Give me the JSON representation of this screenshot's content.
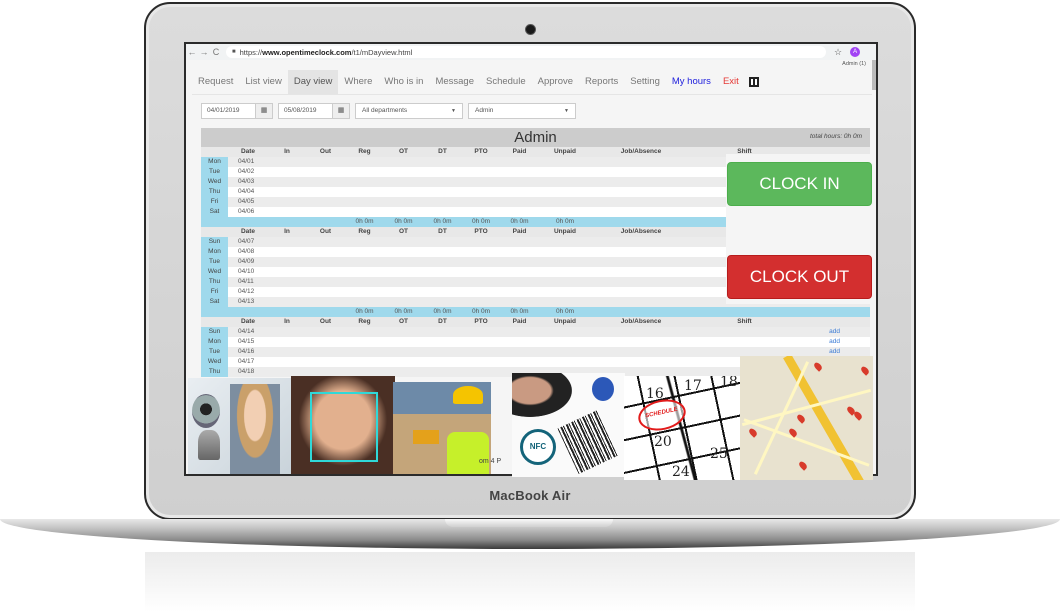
{
  "device": {
    "brand_label": "MacBook Air"
  },
  "browser": {
    "url_prefix": "https://",
    "url_domain": "www.opentimeclock.com",
    "url_path": "/t1/mDayview.html",
    "back_icon": "←",
    "forward_icon": "→",
    "reload_icon": "C",
    "lock_icon": "🔒",
    "star_icon": "☆",
    "avatar_letter": "A",
    "user_label": "Admin (1)"
  },
  "nav": {
    "tabs": [
      {
        "label": "Request"
      },
      {
        "label": "List view"
      },
      {
        "label": "Day view",
        "active": true
      },
      {
        "label": "Where"
      },
      {
        "label": "Who is in"
      },
      {
        "label": "Message"
      },
      {
        "label": "Schedule"
      },
      {
        "label": "Approve"
      },
      {
        "label": "Reports"
      },
      {
        "label": "Setting"
      },
      {
        "label": "My hours"
      },
      {
        "label": "Exit"
      }
    ],
    "qr_icon": "qr-code-icon"
  },
  "filters": {
    "start_date": "04/01/2019",
    "end_date": "05/08/2019",
    "calendar_icon": "▦",
    "department": "All departments",
    "employee": "Admin",
    "caret": "▼"
  },
  "timesheet": {
    "employee_name": "Admin",
    "total_hours": "total hours: 0h 0m",
    "headers": [
      "Date",
      "In",
      "Out",
      "Reg",
      "OT",
      "DT",
      "PTO",
      "Paid",
      "Unpaid",
      "Job/Absence",
      "Shift"
    ],
    "weeks": [
      {
        "days": [
          {
            "day": "Mon",
            "date": "04/01"
          },
          {
            "day": "Tue",
            "date": "04/02"
          },
          {
            "day": "Wed",
            "date": "04/03"
          },
          {
            "day": "Thu",
            "date": "04/04"
          },
          {
            "day": "Fri",
            "date": "04/05"
          },
          {
            "day": "Sat",
            "date": "04/06"
          }
        ],
        "totals": {
          "reg": "0h 0m",
          "ot": "0h 0m",
          "dt": "0h 0m",
          "pto": "0h 0m",
          "paid": "0h 0m",
          "unpaid": "0h 0m"
        }
      },
      {
        "days": [
          {
            "day": "Sun",
            "date": "04/07"
          },
          {
            "day": "Mon",
            "date": "04/08"
          },
          {
            "day": "Tue",
            "date": "04/09"
          },
          {
            "day": "Wed",
            "date": "04/10"
          },
          {
            "day": "Thu",
            "date": "04/11"
          },
          {
            "day": "Fri",
            "date": "04/12"
          },
          {
            "day": "Sat",
            "date": "04/13"
          }
        ],
        "totals": {
          "reg": "0h 0m",
          "ot": "0h 0m",
          "dt": "0h 0m",
          "pto": "0h 0m",
          "paid": "0h 0m",
          "unpaid": "0h 0m"
        }
      },
      {
        "days": [
          {
            "day": "Sun",
            "date": "04/14",
            "add": "add"
          },
          {
            "day": "Mon",
            "date": "04/15",
            "add": "add"
          },
          {
            "day": "Tue",
            "date": "04/16",
            "add": "add"
          },
          {
            "day": "Wed",
            "date": "04/17"
          },
          {
            "day": "Thu",
            "date": "04/18"
          }
        ]
      }
    ]
  },
  "actions": {
    "clock_in": "CLOCK IN",
    "clock_out": "CLOCK OUT",
    "clock_in_color": "#5cb85c",
    "clock_out_color": "#d32f2f"
  },
  "features": {
    "partial_text": "om 4 P",
    "nfc_label": "NFC",
    "schedule_label": "SCHEDULE",
    "calendar_numbers": [
      "16",
      "17",
      "18",
      "20",
      "25",
      "24"
    ]
  }
}
